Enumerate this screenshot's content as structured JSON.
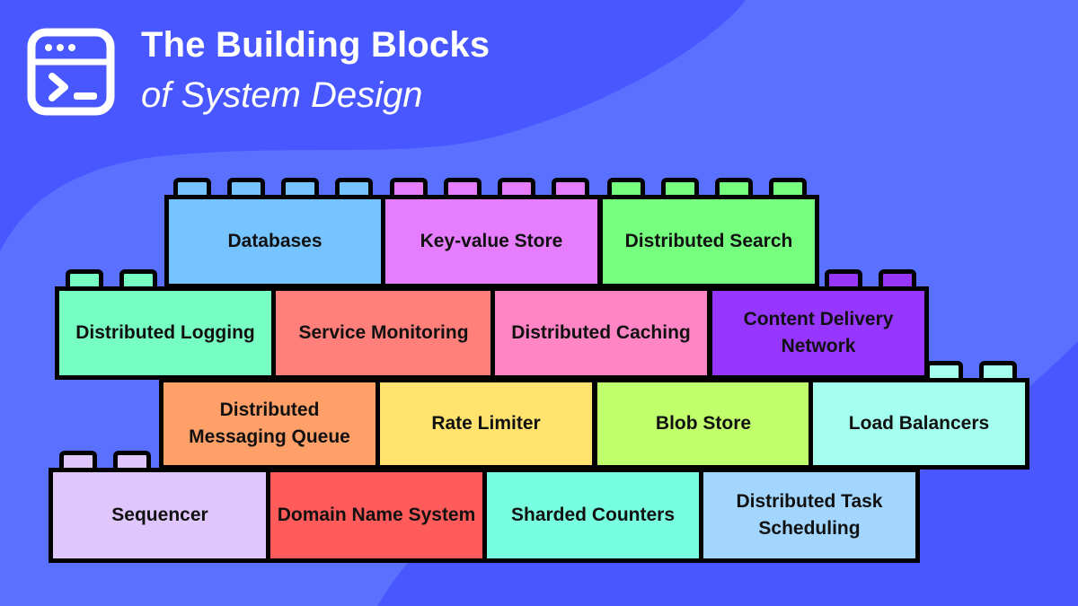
{
  "header": {
    "title": "The Building Blocks",
    "subtitle": "of System Design",
    "logo_icon": "terminal-window-icon"
  },
  "colors": {
    "background": "#4857ff",
    "background_shape": "#5a70ff",
    "brick_outline": "#000000"
  },
  "rows": [
    {
      "name": "row-1",
      "blocks": [
        {
          "label": "Databases",
          "color": "#76c4ff",
          "studs": 4
        },
        {
          "label": "Key-value Store",
          "color": "#e57dfd",
          "studs": 4
        },
        {
          "label": "Distributed Search",
          "color": "#76ff7f",
          "studs": 4
        }
      ]
    },
    {
      "name": "row-2",
      "blocks": [
        {
          "label": "Distributed Logging",
          "color": "#77ffc3",
          "studs": 2
        },
        {
          "label": "Service Monitoring",
          "color": "#ff7f7a",
          "studs": 0
        },
        {
          "label": "Distributed Caching",
          "color": "#ff85c5",
          "studs": 0
        },
        {
          "label": "Content Delivery Network",
          "color": "#9636ff",
          "studs": 2
        }
      ]
    },
    {
      "name": "row-3",
      "blocks": [
        {
          "label": "Distributed Messaging Queue",
          "color": "#ffa068",
          "studs": 0
        },
        {
          "label": "Rate Limiter",
          "color": "#ffe36e",
          "studs": 0
        },
        {
          "label": "Blob Store",
          "color": "#c0ff6b",
          "studs": 0
        },
        {
          "label": "Load Balancers",
          "color": "#a5ffee",
          "studs": 2
        }
      ]
    },
    {
      "name": "row-4",
      "blocks": [
        {
          "label": "Sequencer",
          "color": "#dfc6fb",
          "studs": 2
        },
        {
          "label": "Domain Name System",
          "color": "#ff5b5b",
          "studs": 0
        },
        {
          "label": "Sharded Counters",
          "color": "#78ffe0",
          "studs": 0
        },
        {
          "label": "Distributed Task Scheduling",
          "color": "#a2d6ff",
          "studs": 0
        }
      ]
    }
  ]
}
